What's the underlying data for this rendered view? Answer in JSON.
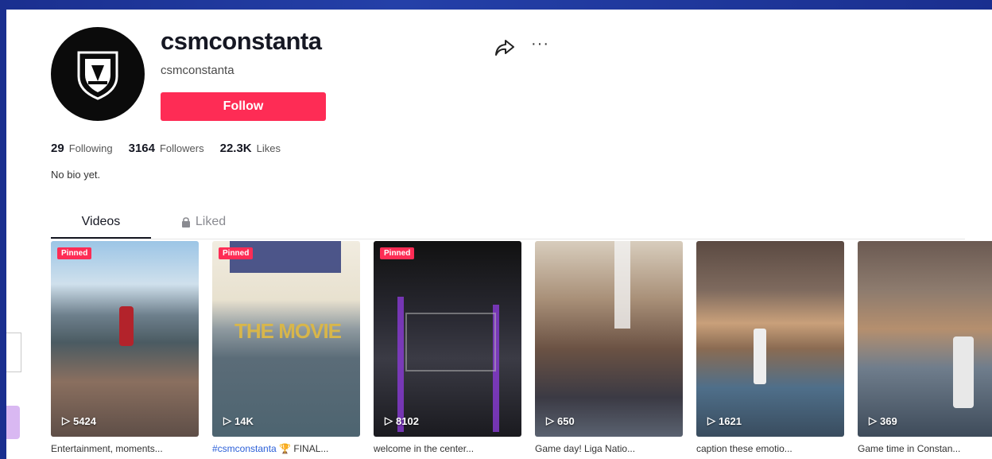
{
  "profile": {
    "username": "csmconstanta",
    "nickname": "csmconstanta",
    "follow_label": "Follow",
    "bio": "No bio yet.",
    "stats": {
      "following_count": "29",
      "following_label": "Following",
      "followers_count": "3164",
      "followers_label": "Followers",
      "likes_count": "22.3K",
      "likes_label": "Likes"
    }
  },
  "icons": {
    "share": "share-icon",
    "more": "more-icon",
    "lock": "lock-icon",
    "play": "play-icon"
  },
  "tabs": {
    "videos": "Videos",
    "liked": "Liked"
  },
  "colors": {
    "accent": "#fe2c55",
    "hashtag": "#2b5fd8",
    "frame": "#132a86"
  },
  "videos": [
    {
      "pinned": "Pinned",
      "views": "5424",
      "caption": "Entertainment, moments..."
    },
    {
      "pinned": "Pinned",
      "views": "14K",
      "hashtag": "#csmconstanta",
      "caption_rest": "FINAL..."
    },
    {
      "pinned": "Pinned",
      "views": "8102",
      "caption": "welcome in the center..."
    },
    {
      "pinned": "",
      "views": "650",
      "caption": "Game day! Liga Natio..."
    },
    {
      "pinned": "",
      "views": "1621",
      "caption": "caption these emotio..."
    },
    {
      "pinned": "",
      "views": "369",
      "caption": "Game time in Constan..."
    }
  ]
}
